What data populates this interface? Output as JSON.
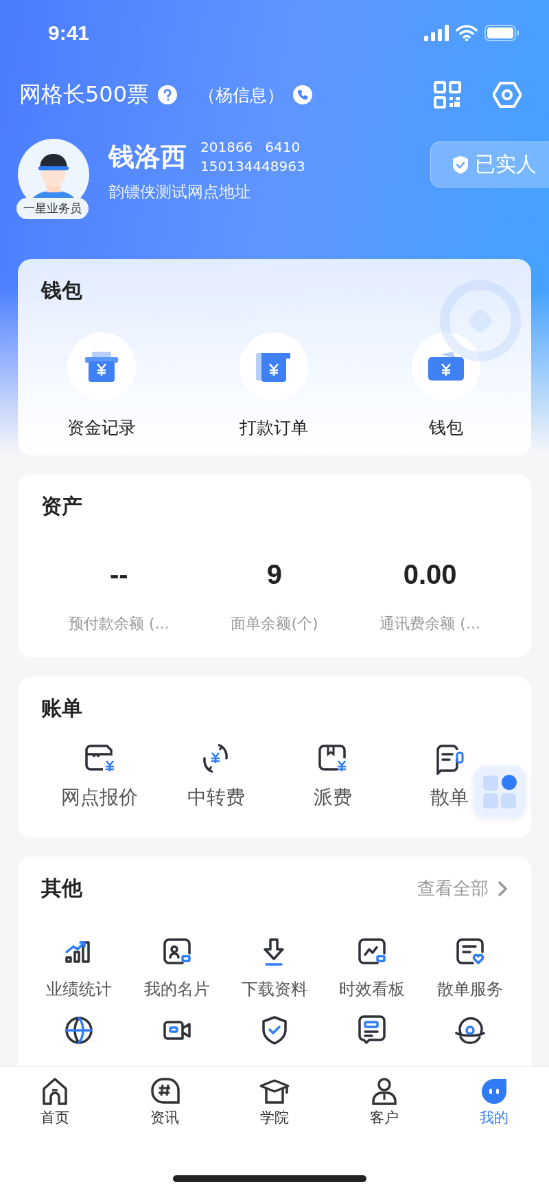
{
  "status_bar": {
    "time": "9:41"
  },
  "header": {
    "title": "网格长500票",
    "contact": "（杨信息）"
  },
  "profile": {
    "name": "钱洛西",
    "code_1": "201866",
    "code_2": "6410",
    "phone": "150134448963",
    "address": "韵镖侠测试网点地址",
    "level_badge": "一星业务员",
    "verified_badge": "已实人"
  },
  "wallet": {
    "title": "钱包",
    "items": [
      {
        "label": "资金记录"
      },
      {
        "label": "打款订单"
      },
      {
        "label": "钱包"
      }
    ]
  },
  "assets": {
    "title": "资产",
    "items": [
      {
        "value": "--",
        "label": "预付款余额 (..."
      },
      {
        "value": "9",
        "label": "面单余额(个)"
      },
      {
        "value": "0.00",
        "label": "通讯费余额 (..."
      }
    ]
  },
  "bills": {
    "title": "账单",
    "items": [
      {
        "label": "网点报价"
      },
      {
        "label": "中转费"
      },
      {
        "label": "派费"
      },
      {
        "label": "散单"
      }
    ]
  },
  "other": {
    "title": "其他",
    "link": "查看全部",
    "items": [
      {
        "kind": "labeled",
        "label": "业绩统计"
      },
      {
        "kind": "labeled",
        "label": "我的名片"
      },
      {
        "kind": "labeled",
        "label": "下载资料"
      },
      {
        "kind": "labeled",
        "label": "时效看板"
      },
      {
        "kind": "labeled",
        "label": "散单服务"
      },
      {
        "kind": "icon"
      },
      {
        "kind": "icon"
      },
      {
        "kind": "icon"
      },
      {
        "kind": "icon"
      },
      {
        "kind": "icon"
      }
    ]
  },
  "tabs": [
    {
      "label": "首页",
      "selected": false
    },
    {
      "label": "资讯",
      "selected": false
    },
    {
      "label": "学院",
      "selected": false
    },
    {
      "label": "客户",
      "selected": false
    },
    {
      "label": "我的",
      "selected": true
    }
  ]
}
